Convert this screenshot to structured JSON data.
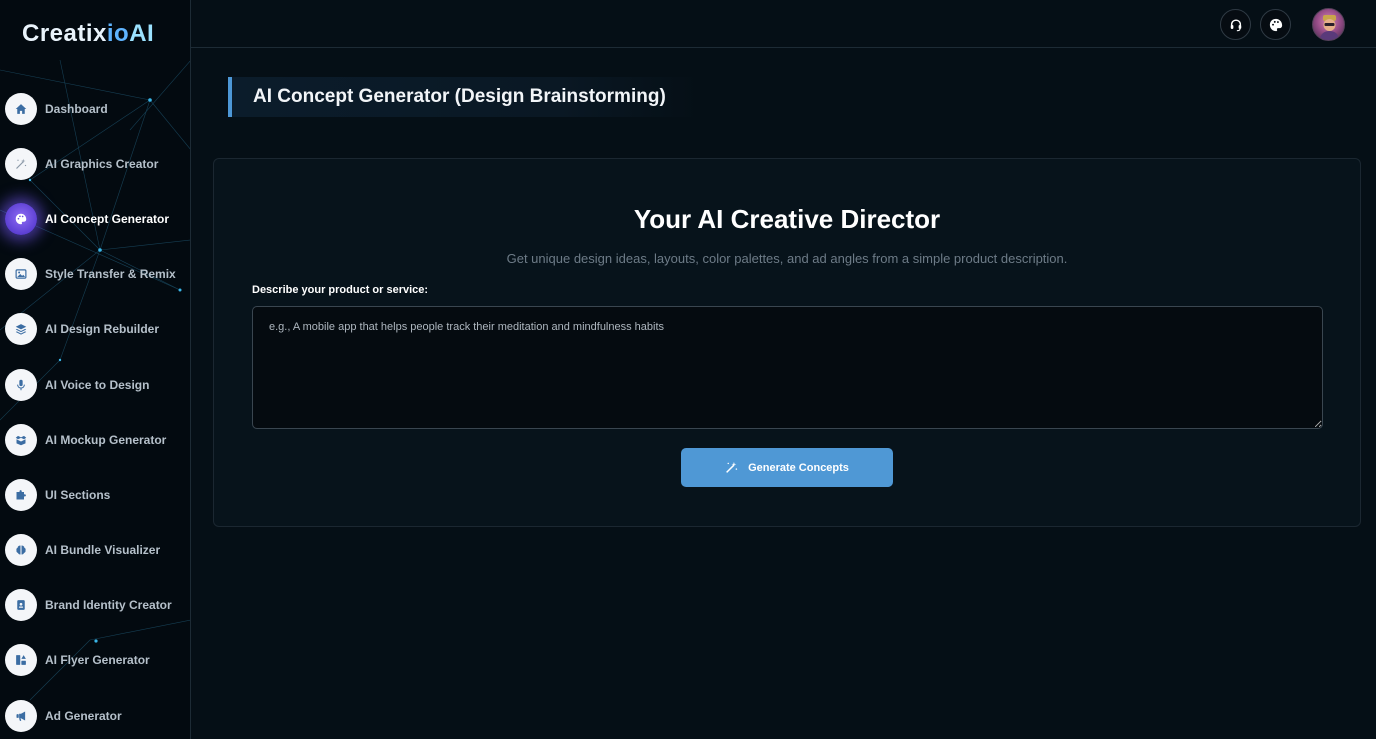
{
  "brand": {
    "logo_part1": "Creatix",
    "logo_part2": "io",
    "logo_part3": "AI"
  },
  "sidebar": {
    "items": [
      {
        "label": "Dashboard",
        "icon": "home-icon",
        "active": false
      },
      {
        "label": "AI Graphics Creator",
        "icon": "magic-wand-icon",
        "active": false
      },
      {
        "label": "AI Concept Generator",
        "icon": "palette-icon",
        "active": true
      },
      {
        "label": "Style Transfer & Remix",
        "icon": "image-icon",
        "active": false
      },
      {
        "label": "AI Design Rebuilder",
        "icon": "layers-icon",
        "active": false
      },
      {
        "label": "AI Voice to Design",
        "icon": "microphone-icon",
        "active": false
      },
      {
        "label": "AI Mockup Generator",
        "icon": "box-icon",
        "active": false
      },
      {
        "label": "UI Sections",
        "icon": "puzzle-icon",
        "active": false
      },
      {
        "label": "AI Bundle Visualizer",
        "icon": "brain-icon",
        "active": false
      },
      {
        "label": "Brand Identity Creator",
        "icon": "id-badge-icon",
        "active": false
      },
      {
        "label": "AI Flyer Generator",
        "icon": "shapes-icon",
        "active": false
      },
      {
        "label": "Ad Generator",
        "icon": "megaphone-icon",
        "active": false
      }
    ]
  },
  "topbar": {
    "icons": [
      "headset-icon",
      "palette-icon"
    ],
    "avatar": "user-avatar"
  },
  "page": {
    "title": "AI Concept Generator (Design Brainstorming)"
  },
  "card": {
    "title": "Your AI Creative Director",
    "subtitle": "Get unique design ideas, layouts, color palettes, and ad angles from a simple product description.",
    "field_label": "Describe your product or service:",
    "textarea_value": "",
    "textarea_placeholder": "e.g., A mobile app that helps people track their meditation and mindfulness habits",
    "button_label": "Generate Concepts",
    "button_icon": "magic-wand-icon"
  },
  "colors": {
    "background": "#050f16",
    "accent": "#4f98d5",
    "active_glow": "#7a5cf0",
    "text_muted": "#6d7b87"
  }
}
